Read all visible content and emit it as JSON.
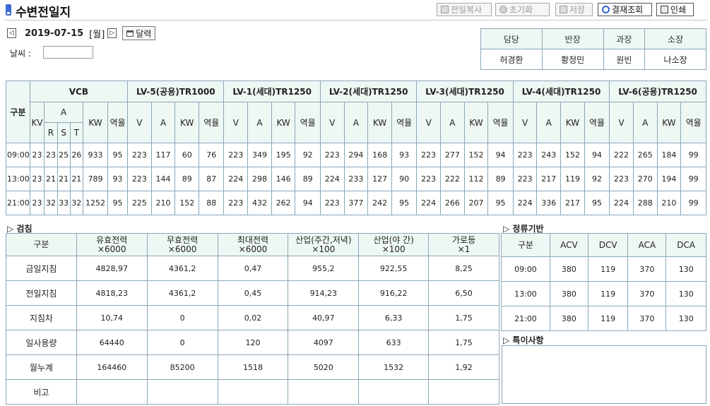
{
  "header": {
    "title": "수변전일지",
    "buttons": {
      "copy_prev": "전일복사",
      "reset": "초기화",
      "save": "저장",
      "approval_view": "결재조회",
      "print": "인쇄"
    }
  },
  "date_nav": {
    "prev": "◁",
    "date": "2019-07-15",
    "weekday": "[월]",
    "next": "▷",
    "calendar": "달력"
  },
  "weather": {
    "label": "날씨 :",
    "value": ""
  },
  "approval": {
    "roles": [
      "담당",
      "반장",
      "과장",
      "소장"
    ],
    "names": [
      "허경환",
      "황정민",
      "원빈",
      "나소장"
    ]
  },
  "main_table": {
    "col_group": "구분",
    "vcb": {
      "title": "VCB",
      "kv": "KV",
      "a": "A",
      "r": "R",
      "s": "S",
      "t": "T",
      "kw": "KW",
      "pf": "역율"
    },
    "lv_groups": [
      "LV-5(공용)TR1000",
      "LV-1(세대)TR1250",
      "LV-2(세대)TR1250",
      "LV-3(세대)TR1250",
      "LV-4(세대)TR1250",
      "LV-6(공용)TR1250"
    ],
    "lv_sub": [
      "V",
      "A",
      "KW",
      "역율"
    ],
    "rows": [
      {
        "time": "09:00",
        "cells": [
          "23",
          "23",
          "25",
          "26",
          "933",
          "95",
          "223",
          "117",
          "60",
          "76",
          "223",
          "349",
          "195",
          "92",
          "223",
          "294",
          "168",
          "93",
          "223",
          "277",
          "152",
          "94",
          "223",
          "243",
          "152",
          "94",
          "222",
          "265",
          "184",
          "99"
        ]
      },
      {
        "time": "13:00",
        "cells": [
          "23",
          "21",
          "21",
          "21",
          "789",
          "93",
          "223",
          "144",
          "89",
          "87",
          "224",
          "298",
          "146",
          "89",
          "224",
          "233",
          "127",
          "90",
          "223",
          "222",
          "112",
          "89",
          "223",
          "217",
          "119",
          "92",
          "223",
          "270",
          "194",
          "99"
        ]
      },
      {
        "time": "21:00",
        "cells": [
          "23",
          "32",
          "33",
          "32",
          "1252",
          "95",
          "225",
          "210",
          "152",
          "88",
          "223",
          "432",
          "262",
          "94",
          "223",
          "377",
          "242",
          "95",
          "224",
          "266",
          "207",
          "95",
          "224",
          "336",
          "217",
          "95",
          "224",
          "288",
          "210",
          "99"
        ]
      }
    ]
  },
  "meter": {
    "section_label": "▷ 검침",
    "headers": [
      {
        "l1": "구분",
        "l2": ""
      },
      {
        "l1": "유효전력",
        "l2": "×6000"
      },
      {
        "l1": "무효전력",
        "l2": "×6000"
      },
      {
        "l1": "최대전력",
        "l2": "×6000"
      },
      {
        "l1": "산업(주간,저녁)",
        "l2": "×100"
      },
      {
        "l1": "산업(야  간)",
        "l2": "×100"
      },
      {
        "l1": "가로등",
        "l2": "×1"
      }
    ],
    "rows": [
      {
        "label": "금일지침",
        "cells": [
          "4828,97",
          "4361,2",
          "0,47",
          "955,2",
          "922,55",
          "8,25"
        ]
      },
      {
        "label": "전일지침",
        "cells": [
          "4818,23",
          "4361,2",
          "0,45",
          "914,23",
          "916,22",
          "6,50"
        ]
      },
      {
        "label": "지침차",
        "cells": [
          "10,74",
          "0",
          "0,02",
          "40,97",
          "6,33",
          "1,75"
        ]
      },
      {
        "label": "일사용량",
        "cells": [
          "64440",
          "0",
          "120",
          "4097",
          "633",
          "1,75"
        ]
      },
      {
        "label": "월누계",
        "cells": [
          "164460",
          "85200",
          "1518",
          "5020",
          "1532",
          "1,92"
        ]
      },
      {
        "label": "비고",
        "cells": [
          "",
          "",
          "",
          "",
          "",
          ""
        ]
      }
    ]
  },
  "rectifier": {
    "section_label": "▷ 정류기반",
    "headers": [
      "구분",
      "ACV",
      "DCV",
      "ACA",
      "DCA"
    ],
    "rows": [
      {
        "time": "09:00",
        "cells": [
          "380",
          "119",
          "370",
          "130"
        ]
      },
      {
        "time": "13:00",
        "cells": [
          "380",
          "119",
          "370",
          "130"
        ]
      },
      {
        "time": "21:00",
        "cells": [
          "380",
          "119",
          "370",
          "130"
        ]
      }
    ]
  },
  "notes": {
    "section_label": "▷ 특이사항",
    "value": ""
  }
}
